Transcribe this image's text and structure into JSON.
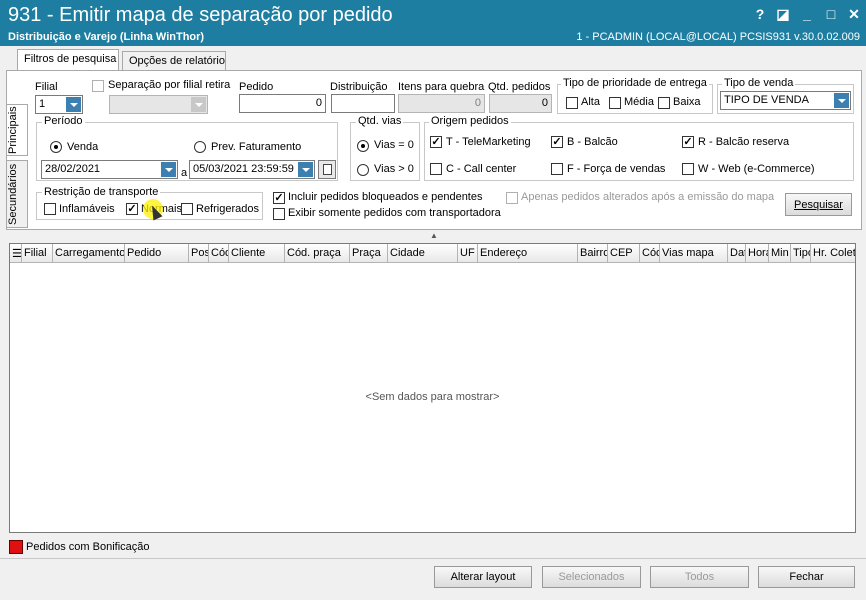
{
  "window": {
    "title": "931 - Emitir mapa de separação por pedido",
    "subtitle": "Distribuição e Varejo (Linha WinThor)",
    "user_info": "1 - PCADMIN (LOCAL@LOCAL)   PCSIS931  v.30.0.02.009",
    "help_label": "?",
    "restore_label": "◪",
    "minimize_label": "_",
    "maximize_label": "□",
    "close_label": "✕"
  },
  "tabs": [
    "Filtros de pesquisa",
    "Opções de relatório"
  ],
  "side_tabs": [
    "Principais",
    "Secundários"
  ],
  "filters": {
    "filial_label": "Filial",
    "filial_value": "1",
    "separacao_label": "Separação por filial retira",
    "pedido_label": "Pedido",
    "pedido_value": "0",
    "distribuicao_label": "Distribuição",
    "distribuicao_value": "",
    "itens_quebra_label": "Itens para quebra",
    "itens_quebra_value": "0",
    "qtd_pedidos_label": "Qtd. pedidos",
    "qtd_pedidos_value": "0",
    "prioridade_label": "Tipo de prioridade de  entrega",
    "prioridade_options": [
      "Alta",
      "Média",
      "Baixa"
    ],
    "tipo_venda_label": "Tipo de venda",
    "tipo_venda_value": "TIPO DE VENDA",
    "periodo_label": "Período",
    "venda_label": "Venda",
    "prev_faturamento_label": "Prev. Faturamento",
    "data_inicio": "28/02/2021",
    "data_a_label": "a",
    "data_fim": "05/03/2021 23:59:59",
    "qtd_vias_label": "Qtd. vias",
    "vias_0": "Vias = 0",
    "vias_gt0": "Vias > 0",
    "origem_label": "Origem pedidos",
    "origem": [
      {
        "label": "T - TeleMarketing",
        "checked": true
      },
      {
        "label": "B - Balcão",
        "checked": true
      },
      {
        "label": "R - Balcão reserva",
        "checked": true
      },
      {
        "label": "C - Call center",
        "checked": false
      },
      {
        "label": "F - Força de vendas",
        "checked": false
      },
      {
        "label": "W - Web (e-Commerce)",
        "checked": false
      }
    ],
    "restricao_label": "Restrição de transporte",
    "restricao": [
      {
        "label": "Inflamáveis",
        "checked": false
      },
      {
        "label": "Normais",
        "checked": true
      },
      {
        "label": "Refrigerados",
        "checked": false
      }
    ],
    "incluir_bloqueados": "Incluir pedidos bloqueados e pendentes",
    "exibir_transportadora": "Exibir somente pedidos com transportadora",
    "apenas_alterados": "Apenas pedidos alterados após a emissão do mapa",
    "pesquisar_label": "Pesquisar"
  },
  "grid": {
    "columns": [
      "Filial",
      "Carregamento",
      "Pedido",
      "Posição",
      "Cód",
      "Cliente",
      "Cód. praça",
      "Praça",
      "Cidade",
      "UF",
      "Endereço",
      "Bairro",
      "CEP",
      "Cód",
      "Vias mapa",
      "Data",
      "Hora",
      "Min",
      "Tipo",
      "Hr. Coleta"
    ],
    "empty_text": "<Sem dados para mostrar>"
  },
  "legend": {
    "color": "#e01010",
    "label": "Pedidos com Bonificação"
  },
  "footer": {
    "alterar_layout": "Alterar layout",
    "selecionados": "Selecionados",
    "todos": "Todos",
    "fechar": "Fechar"
  }
}
